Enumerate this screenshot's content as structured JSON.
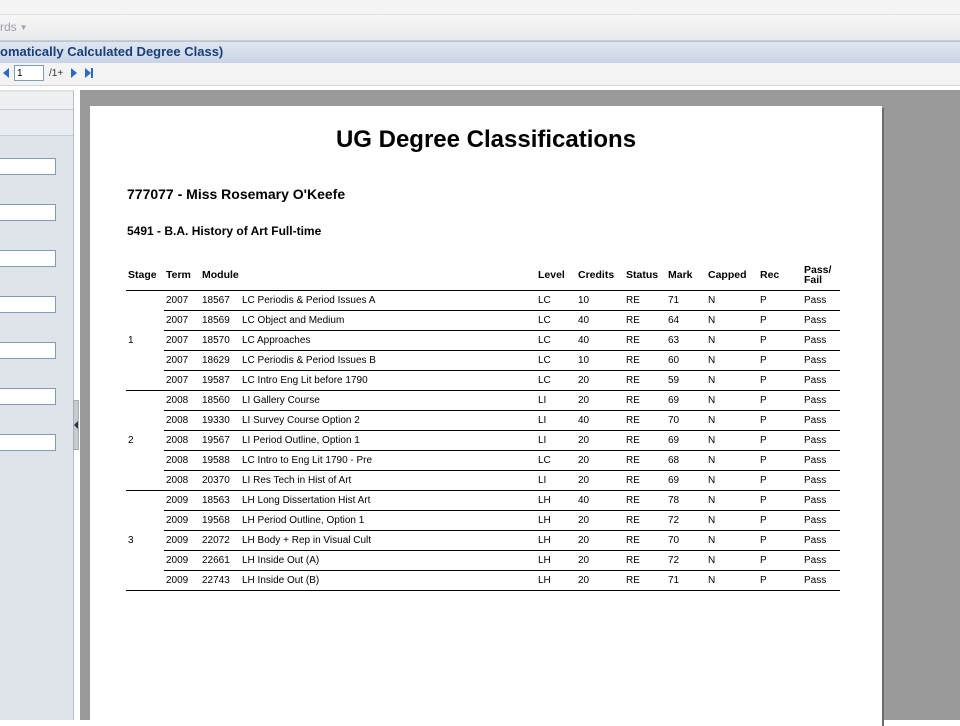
{
  "menu": {
    "label": "rds"
  },
  "window": {
    "title": "omatically Calculated Degree Class)"
  },
  "toolbar": {
    "page": "1",
    "total": "/1+"
  },
  "report": {
    "title": "UG Degree Classifications",
    "student": "777077 - Miss Rosemary O'Keefe",
    "course": "5491 - B.A. History of Art Full-time",
    "headers": {
      "stage": "Stage",
      "term": "Term",
      "module": "Module",
      "level": "Level",
      "credits": "Credits",
      "status": "Status",
      "mark": "Mark",
      "capped": "Capped",
      "rec": "Rec",
      "pass_fail_1": "Pass/",
      "pass_fail_2": "Fail"
    },
    "stages": [
      {
        "stage": "1",
        "rows": [
          {
            "term": "2007",
            "code": "18567",
            "name": "LC Periodis & Period Issues A",
            "level": "LC",
            "credits": "10",
            "status": "RE",
            "mark": "71",
            "capped": "N",
            "rec": "P",
            "result": "Pass"
          },
          {
            "term": "2007",
            "code": "18569",
            "name": "LC Object and Medium",
            "level": "LC",
            "credits": "40",
            "status": "RE",
            "mark": "64",
            "capped": "N",
            "rec": "P",
            "result": "Pass"
          },
          {
            "term": "2007",
            "code": "18570",
            "name": "LC Approaches",
            "level": "LC",
            "credits": "40",
            "status": "RE",
            "mark": "63",
            "capped": "N",
            "rec": "P",
            "result": "Pass"
          },
          {
            "term": "2007",
            "code": "18629",
            "name": "LC Periodis & Period Issues B",
            "level": "LC",
            "credits": "10",
            "status": "RE",
            "mark": "60",
            "capped": "N",
            "rec": "P",
            "result": "Pass"
          },
          {
            "term": "2007",
            "code": "19587",
            "name": "LC Intro Eng Lit before 1790",
            "level": "LC",
            "credits": "20",
            "status": "RE",
            "mark": "59",
            "capped": "N",
            "rec": "P",
            "result": "Pass"
          }
        ]
      },
      {
        "stage": "2",
        "rows": [
          {
            "term": "2008",
            "code": "18560",
            "name": "LI Gallery Course",
            "level": "LI",
            "credits": "20",
            "status": "RE",
            "mark": "69",
            "capped": "N",
            "rec": "P",
            "result": "Pass"
          },
          {
            "term": "2008",
            "code": "19330",
            "name": "LI Survey Course Option 2",
            "level": "LI",
            "credits": "40",
            "status": "RE",
            "mark": "70",
            "capped": "N",
            "rec": "P",
            "result": "Pass"
          },
          {
            "term": "2008",
            "code": "19567",
            "name": "LI Period Outline, Option 1",
            "level": "LI",
            "credits": "20",
            "status": "RE",
            "mark": "69",
            "capped": "N",
            "rec": "P",
            "result": "Pass"
          },
          {
            "term": "2008",
            "code": "19588",
            "name": "LC Intro to Eng Lit 1790 - Pre",
            "level": "LC",
            "credits": "20",
            "status": "RE",
            "mark": "68",
            "capped": "N",
            "rec": "P",
            "result": "Pass"
          },
          {
            "term": "2008",
            "code": "20370",
            "name": "LI Res Tech in Hist of Art",
            "level": "LI",
            "credits": "20",
            "status": "RE",
            "mark": "69",
            "capped": "N",
            "rec": "P",
            "result": "Pass"
          }
        ]
      },
      {
        "stage": "3",
        "rows": [
          {
            "term": "2009",
            "code": "18563",
            "name": "LH Long Dissertation Hist Art",
            "level": "LH",
            "credits": "40",
            "status": "RE",
            "mark": "78",
            "capped": "N",
            "rec": "P",
            "result": "Pass"
          },
          {
            "term": "2009",
            "code": "19568",
            "name": "LH Period Outline, Option 1",
            "level": "LH",
            "credits": "20",
            "status": "RE",
            "mark": "72",
            "capped": "N",
            "rec": "P",
            "result": "Pass"
          },
          {
            "term": "2009",
            "code": "22072",
            "name": "LH Body + Rep in Visual Cult",
            "level": "LH",
            "credits": "20",
            "status": "RE",
            "mark": "70",
            "capped": "N",
            "rec": "P",
            "result": "Pass"
          },
          {
            "term": "2009",
            "code": "22661",
            "name": "LH Inside Out (A)",
            "level": "LH",
            "credits": "20",
            "status": "RE",
            "mark": "72",
            "capped": "N",
            "rec": "P",
            "result": "Pass"
          },
          {
            "term": "2009",
            "code": "22743",
            "name": "LH Inside Out (B)",
            "level": "LH",
            "credits": "20",
            "status": "RE",
            "mark": "71",
            "capped": "N",
            "rec": "P",
            "result": "Pass"
          }
        ]
      }
    ]
  }
}
